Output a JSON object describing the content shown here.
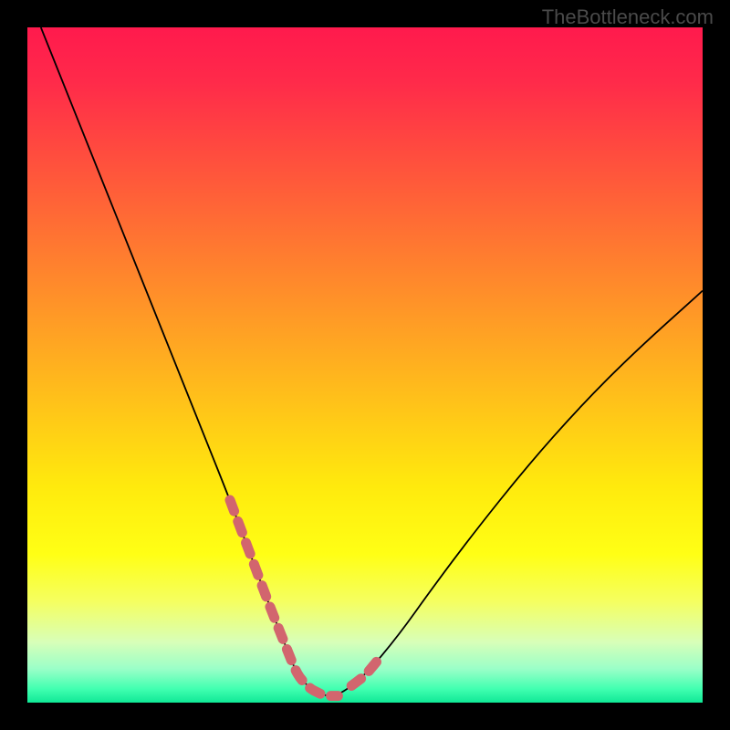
{
  "watermark": "TheBottleneck.com",
  "colors": {
    "background": "#000000",
    "gradient_top": "#ff1a4d",
    "gradient_mid": "#ffea0d",
    "gradient_bottom": "#10e896",
    "curve": "#000000",
    "accent_dash": "#d2656e"
  },
  "chart_data": {
    "type": "line",
    "title": "",
    "xlabel": "",
    "ylabel": "",
    "xlim": [
      0,
      100
    ],
    "ylim": [
      0,
      100
    ],
    "grid": false,
    "legend": false,
    "series": [
      {
        "name": "bottleneck-curve",
        "x": [
          2,
          6,
          10,
          14,
          18,
          22,
          26,
          30,
          33,
          36,
          38,
          40,
          42,
          44,
          46,
          50,
          55,
          60,
          66,
          74,
          82,
          90,
          100
        ],
        "values": [
          100,
          90,
          80,
          70,
          60,
          50,
          40,
          30,
          22,
          14,
          9,
          4,
          2,
          1,
          1,
          4,
          10,
          17,
          25,
          35,
          44,
          52,
          61
        ]
      }
    ],
    "accent_ranges_x": [
      {
        "from": 30,
        "to": 46
      },
      {
        "from": 48,
        "to": 52
      }
    ]
  }
}
